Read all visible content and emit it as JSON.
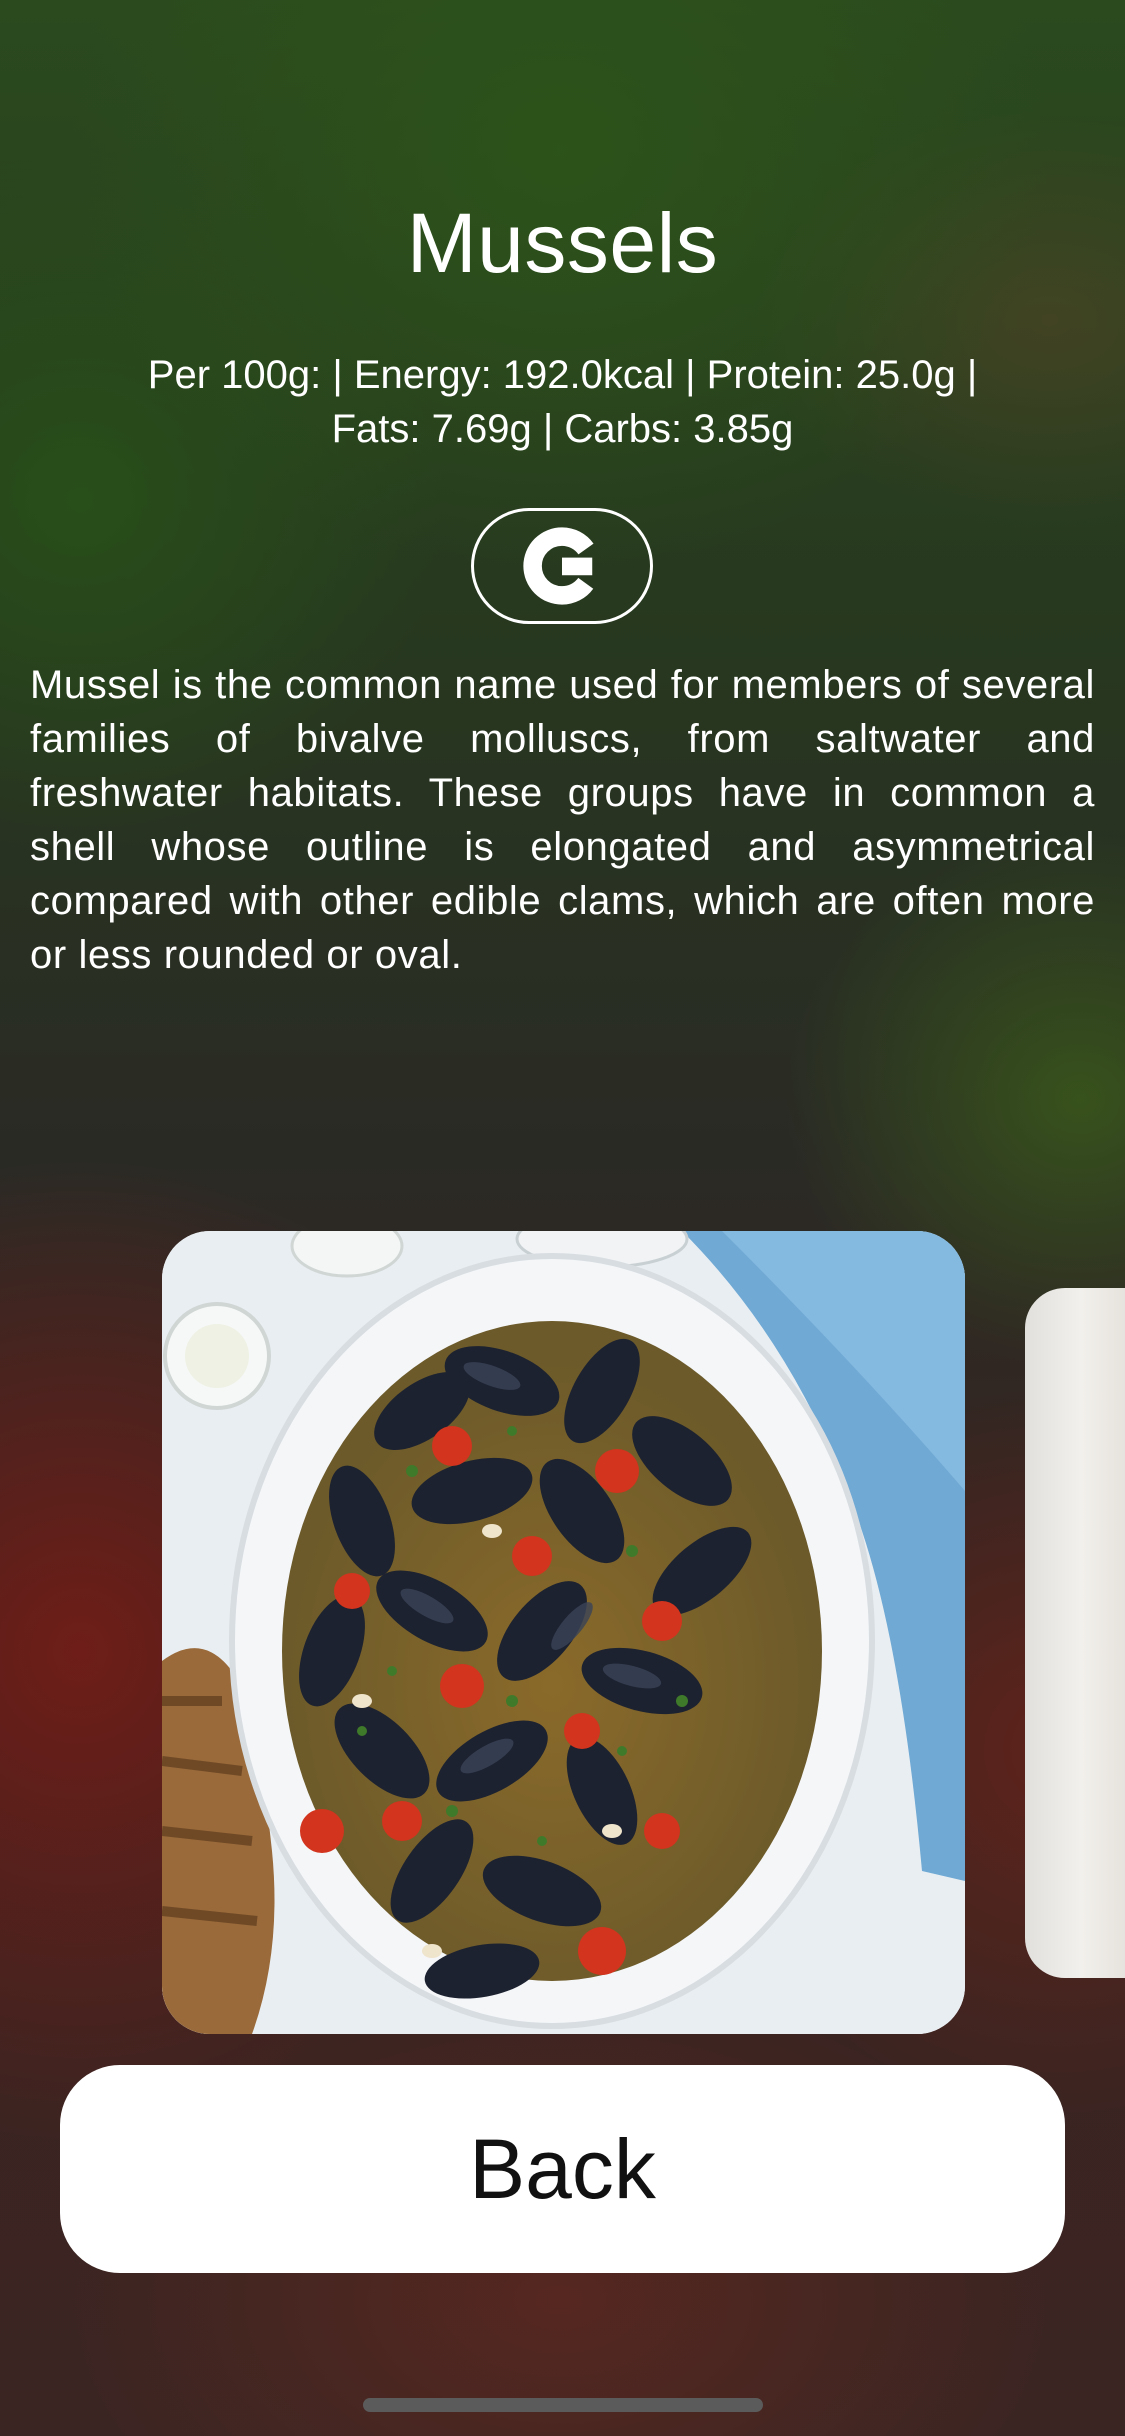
{
  "food": {
    "title": "Mussels",
    "nutrition_line1": "Per 100g: | Energy: 192.0kcal | Protein: 25.0g |",
    "nutrition_line2": "Fats: 7.69g | Carbs: 3.85g",
    "description": "Mussel is the common name used for members of several families of bivalve molluscs, from saltwater and freshwater habitats. These groups have in common a shell whose outline is elongated and asymmetrical compared with other edible clams, which are often more or less rounded or oval."
  },
  "google_button": {
    "icon": "google-g-icon"
  },
  "gallery": {
    "images": [
      {
        "subject": "mussels-dish-photo"
      },
      {
        "subject": "next-dish-photo-partial"
      }
    ]
  },
  "actions": {
    "back_label": "Back"
  },
  "colors": {
    "button_background": "#ffffff",
    "button_text": "#111111",
    "text": "#ffffff"
  }
}
